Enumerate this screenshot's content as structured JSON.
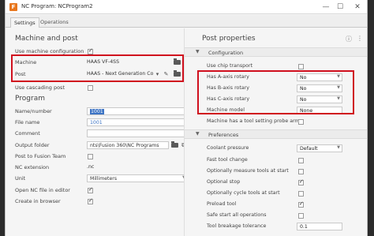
{
  "window": {
    "title": "NC Program: NCProgram2",
    "app_icon": "orange-app-icon",
    "controls": {
      "minimize": "—",
      "maximize": "☐",
      "close": "✕"
    }
  },
  "tabs": [
    {
      "label": "Settings",
      "active": true
    },
    {
      "label": "Operations",
      "active": false
    }
  ],
  "left": {
    "machine_and_post": {
      "title": "Machine and post",
      "use_machine_config_label": "Use machine configuration",
      "use_machine_config_checked": true,
      "machine_label": "Machine",
      "machine_value": "HAAS VF-4SS",
      "post_label": "Post",
      "post_value": "HAAS - Next Generation Co",
      "use_cascading_post_label": "Use cascading post",
      "use_cascading_post_checked": false
    },
    "program": {
      "title": "Program",
      "name_label": "Name/number",
      "name_value": "1001",
      "file_name_label": "File name",
      "file_name_value": "1001",
      "comment_label": "Comment",
      "comment_value": "",
      "output_folder_label": "Output folder",
      "output_folder_value": "nts\\Fusion 360\\NC Programs",
      "post_to_team_label": "Post to Fusion Team",
      "post_to_team_checked": false,
      "nc_extension_label": "NC extension",
      "nc_extension_value": ".nc",
      "unit_label": "Unit",
      "unit_value": "Millimeters",
      "open_nc_label": "Open NC file in editor",
      "open_nc_checked": true,
      "create_in_browser_label": "Create in browser",
      "create_in_browser_checked": true
    }
  },
  "right": {
    "title": "Post properties",
    "configuration_group": "Configuration",
    "preferences_group": "Preferences",
    "config_rows": [
      {
        "label": "Use chip transport",
        "type": "checkbox",
        "checked": false
      },
      {
        "label": "Has A-axis rotary",
        "type": "select",
        "value": "No"
      },
      {
        "label": "Has B-axis rotary",
        "type": "select",
        "value": "No"
      },
      {
        "label": "Has C-axis rotary",
        "type": "select",
        "value": "No"
      },
      {
        "label": "Machine model",
        "type": "select",
        "value": "None"
      },
      {
        "label": "Machine has a tool setting probe arm",
        "type": "checkbox",
        "checked": false
      }
    ],
    "pref_rows": [
      {
        "label": "Coolant pressure",
        "type": "select",
        "value": "Default"
      },
      {
        "label": "Fast tool change",
        "type": "checkbox",
        "checked": false
      },
      {
        "label": "Optionally measure tools at start",
        "type": "checkbox",
        "checked": false
      },
      {
        "label": "Optional stop",
        "type": "checkbox",
        "checked": true
      },
      {
        "label": "Optionally cycle tools at start",
        "type": "checkbox",
        "checked": false
      },
      {
        "label": "Preload tool",
        "type": "checkbox",
        "checked": true
      },
      {
        "label": "Safe start all operations",
        "type": "checkbox",
        "checked": false
      },
      {
        "label": "Tool breakage tolerance",
        "type": "number",
        "value": "0.1"
      }
    ]
  }
}
